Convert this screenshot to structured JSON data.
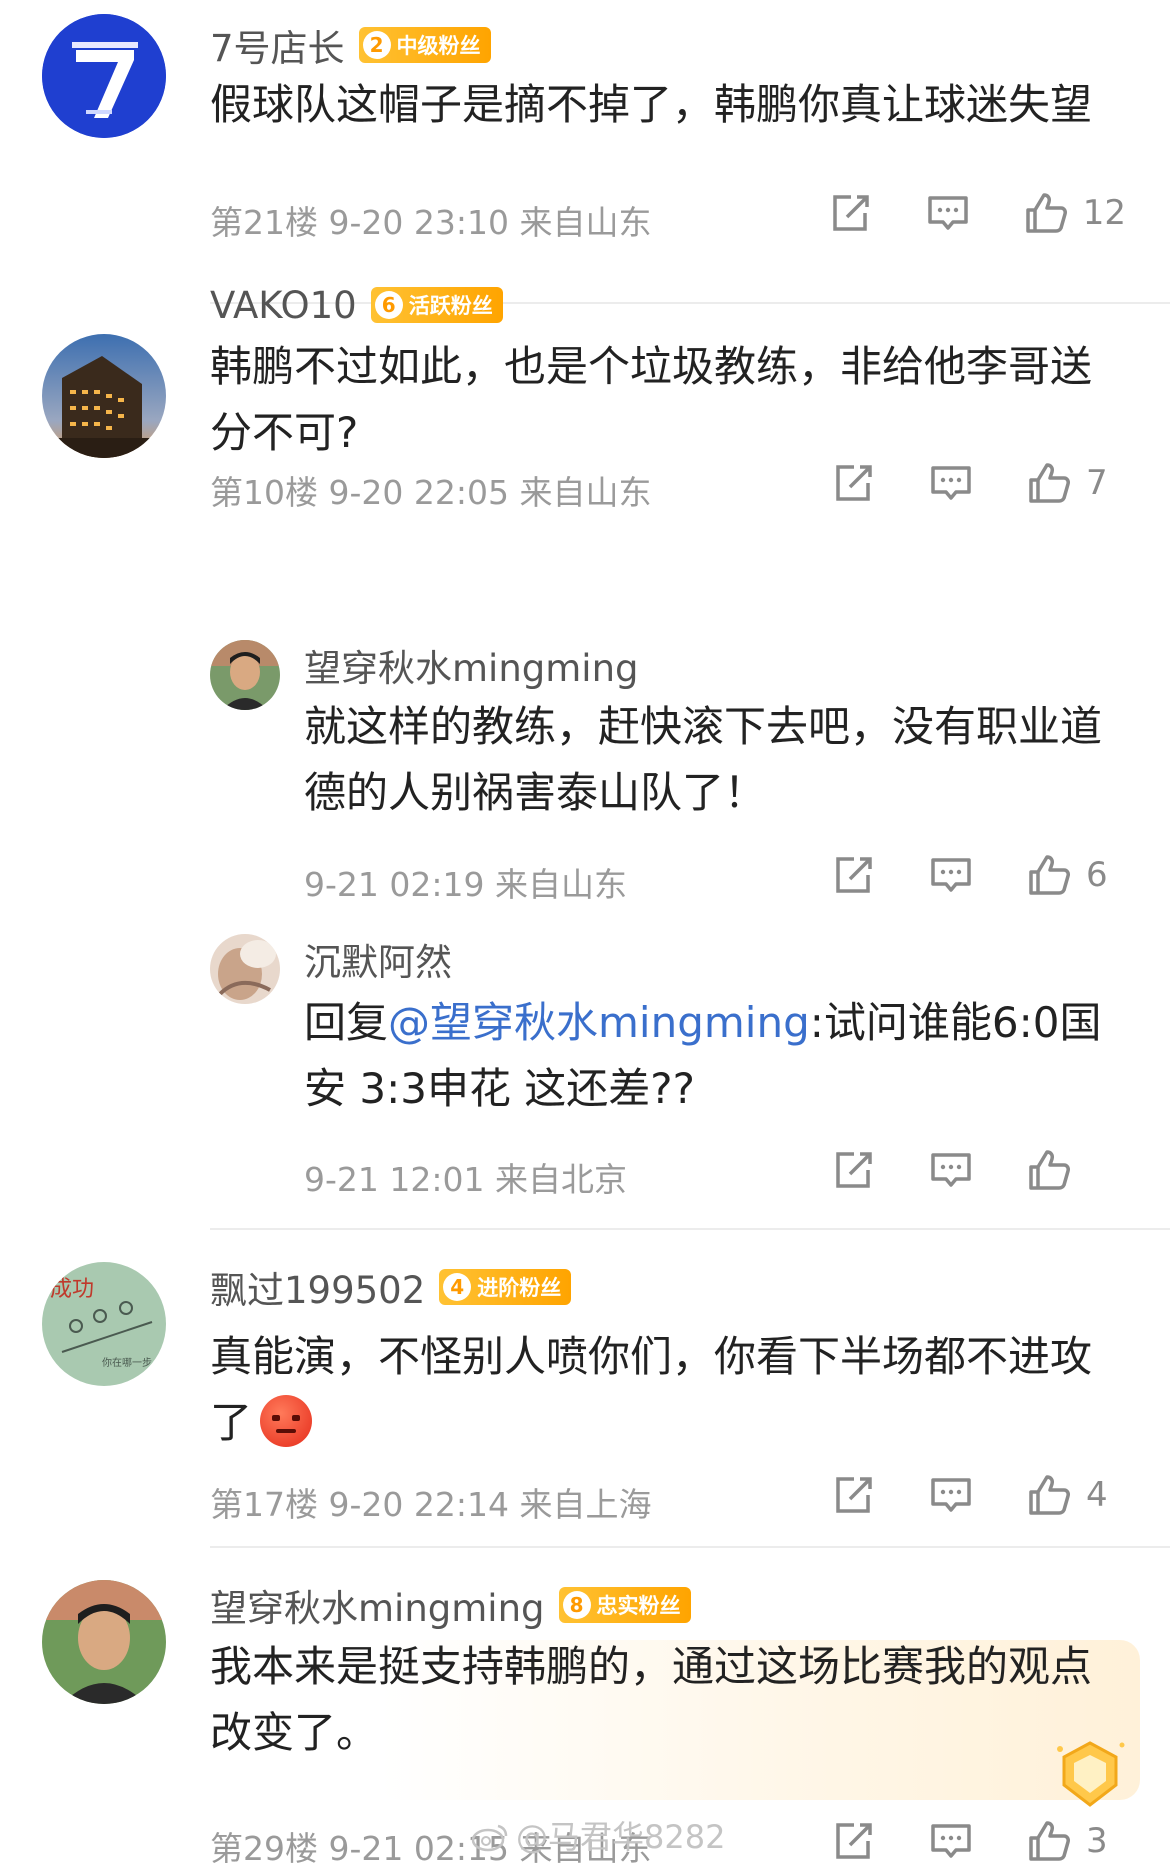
{
  "comments": [
    {
      "username": "7号店长",
      "badge_level": "2",
      "badge_label": "中级粉丝",
      "text": "假球队这帽子是摘不掉了，韩鹏你真让球迷失望",
      "floor": "第21楼",
      "time": "9-20 23:10",
      "location": "来自山东",
      "likes": "12",
      "avatar_icon": "number-7-logo"
    },
    {
      "username": "VAKO10",
      "badge_level": "6",
      "badge_label": "活跃粉丝",
      "text": "韩鹏不过如此，也是个垃圾教练，非给他李哥送分不可?",
      "floor": "第10楼",
      "time": "9-20 22:05",
      "location": "来自山东",
      "likes": "7",
      "avatar_icon": "night-building-photo",
      "replies": [
        {
          "username": "望穿秋水mingming",
          "text": "就这样的教练，赶快滚下去吧，没有职业道德的人别祸害泰山队了！",
          "time": "9-21 02:19",
          "location": "来自山东",
          "likes": "6"
        },
        {
          "username": "沉默阿然",
          "reply_prefix": "回复",
          "mention": "@望穿秋水mingming",
          "text": ":试问谁能6:0国安 3:3申花 这还差??",
          "time": "9-21 12:01",
          "location": "来自北京",
          "likes": ""
        }
      ]
    },
    {
      "username": "飘过199502",
      "badge_level": "4",
      "badge_label": "进阶粉丝",
      "text": "真能演，不怪别人喷你们，你看下半场都不进攻了",
      "floor": "第17楼",
      "time": "9-20 22:14",
      "location": "来自上海",
      "likes": "4",
      "emoji": "angry-face-emoji"
    },
    {
      "username": "望穿秋水mingming",
      "badge_level": "8",
      "badge_label": "忠实粉丝",
      "text": "我本来是挺支持韩鹏的，通过这场比赛我的观点改变了。",
      "floor": "第29楼",
      "time": "9-21 02:15",
      "location": "来自山东",
      "likes": "3"
    }
  ],
  "watermark": "@马君华8282",
  "colors": {
    "badge": "#ffa400",
    "link": "#3a6fcc",
    "meta": "#9a9a9a",
    "avatar1_bg": "#1f3fd0"
  }
}
